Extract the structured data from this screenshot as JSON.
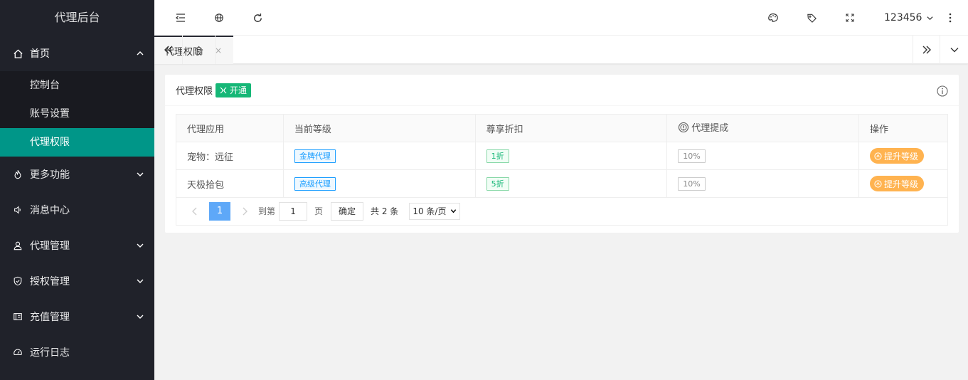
{
  "app": {
    "title": "代理后台"
  },
  "sidebar": {
    "home": {
      "label": "首页",
      "icon": "home-icon"
    },
    "home_children": [
      {
        "label": "控制台",
        "active": false
      },
      {
        "label": "账号设置",
        "active": false
      },
      {
        "label": "代理权限",
        "active": true
      }
    ],
    "items": [
      {
        "label": "更多功能",
        "icon": "fire-icon",
        "expandable": true
      },
      {
        "label": "消息中心",
        "icon": "speaker-icon",
        "expandable": false
      },
      {
        "label": "代理管理",
        "icon": "user-icon",
        "expandable": true
      },
      {
        "label": "授权管理",
        "icon": "shield-icon",
        "expandable": true
      },
      {
        "label": "充值管理",
        "icon": "wallet-icon",
        "expandable": true
      },
      {
        "label": "运行日志",
        "icon": "dashboard-icon",
        "expandable": false
      }
    ],
    "active_color": "#009688"
  },
  "header": {
    "user": "123456"
  },
  "tabs": {
    "current": "代理权限",
    "close": "×"
  },
  "card": {
    "title": "代理权限",
    "badge": "开通",
    "table": {
      "headers": [
        "代理应用",
        "当前等级",
        "尊享折扣",
        "代理提成",
        "操作"
      ],
      "rows": [
        {
          "app": "宠物：远征",
          "level": "金牌代理",
          "discount": "1折",
          "commission": "10%",
          "action": "提升等级"
        },
        {
          "app": "天极拾包",
          "level": "高级代理",
          "discount": "5折",
          "commission": "10%",
          "action": "提升等级"
        }
      ]
    },
    "pager": {
      "current_page": "1",
      "goto_label": "到第",
      "goto_value": "1",
      "page_unit": "页",
      "confirm": "确定",
      "total": "共 2 条",
      "page_size": "10 条/页"
    }
  }
}
